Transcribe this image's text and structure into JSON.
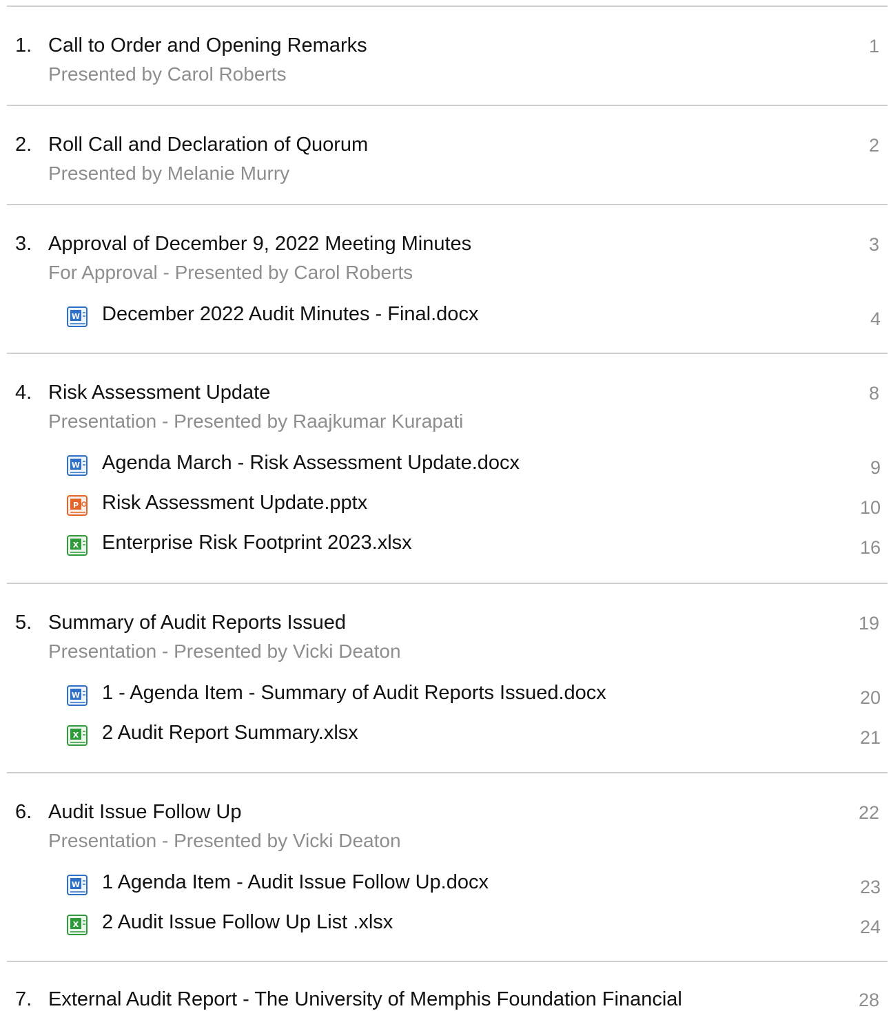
{
  "items": [
    {
      "number": "1.",
      "title": "Call to Order and Opening Remarks",
      "subtitle": "Presented by Carol Roberts",
      "page": "1",
      "attachments": []
    },
    {
      "number": "2.",
      "title": "Roll Call and Declaration of Quorum",
      "subtitle": "Presented by Melanie Murry",
      "page": "2",
      "attachments": []
    },
    {
      "number": "3.",
      "title": "Approval of December 9, 2022 Meeting Minutes",
      "subtitle": "For Approval - Presented by Carol Roberts",
      "page": "3",
      "attachments": [
        {
          "label": "December 2022 Audit Minutes - Final.docx",
          "page": "4",
          "icon": "word-doc-icon"
        }
      ]
    },
    {
      "number": "4.",
      "title": "Risk Assessment Update",
      "subtitle": "Presentation - Presented by Raajkumar Kurapati",
      "page": "8",
      "attachments": [
        {
          "label": "Agenda March  - Risk Assessment Update.docx",
          "page": "9",
          "icon": "word-doc-icon"
        },
        {
          "label": "Risk Assessment Update.pptx",
          "page": "10",
          "icon": "powerpoint-doc-icon"
        },
        {
          "label": "Enterprise Risk Footprint 2023.xlsx",
          "page": "16",
          "icon": "excel-doc-icon"
        }
      ]
    },
    {
      "number": "5.",
      "title": "Summary of Audit Reports Issued",
      "subtitle": "Presentation - Presented by Vicki Deaton",
      "page": "19",
      "attachments": [
        {
          "label": "1 - Agenda Item - Summary of Audit Reports Issued.docx",
          "page": "20",
          "icon": "word-doc-icon"
        },
        {
          "label": "2 Audit Report Summary.xlsx",
          "page": "21",
          "icon": "excel-doc-icon"
        }
      ]
    },
    {
      "number": "6.",
      "title": "Audit Issue Follow Up",
      "subtitle": "Presentation - Presented by Vicki Deaton",
      "page": "22",
      "attachments": [
        {
          "label": "1 Agenda Item - Audit Issue Follow Up.docx",
          "page": "23",
          "icon": "word-doc-icon"
        },
        {
          "label": "2 Audit Issue Follow Up List .xlsx",
          "page": "24",
          "icon": "excel-doc-icon"
        }
      ]
    },
    {
      "number": "7.",
      "title": "External Audit Report - The University of Memphis Foundation Financial",
      "subtitle": "",
      "page": "28",
      "attachments": []
    }
  ],
  "colors": {
    "title_text": "#111111",
    "muted_text": "#8e8e8e",
    "divider": "#cfcfcf",
    "word_blue": "#2f6fc7",
    "powerpoint_orange": "#e2652b",
    "excel_green": "#2f9a3a"
  }
}
